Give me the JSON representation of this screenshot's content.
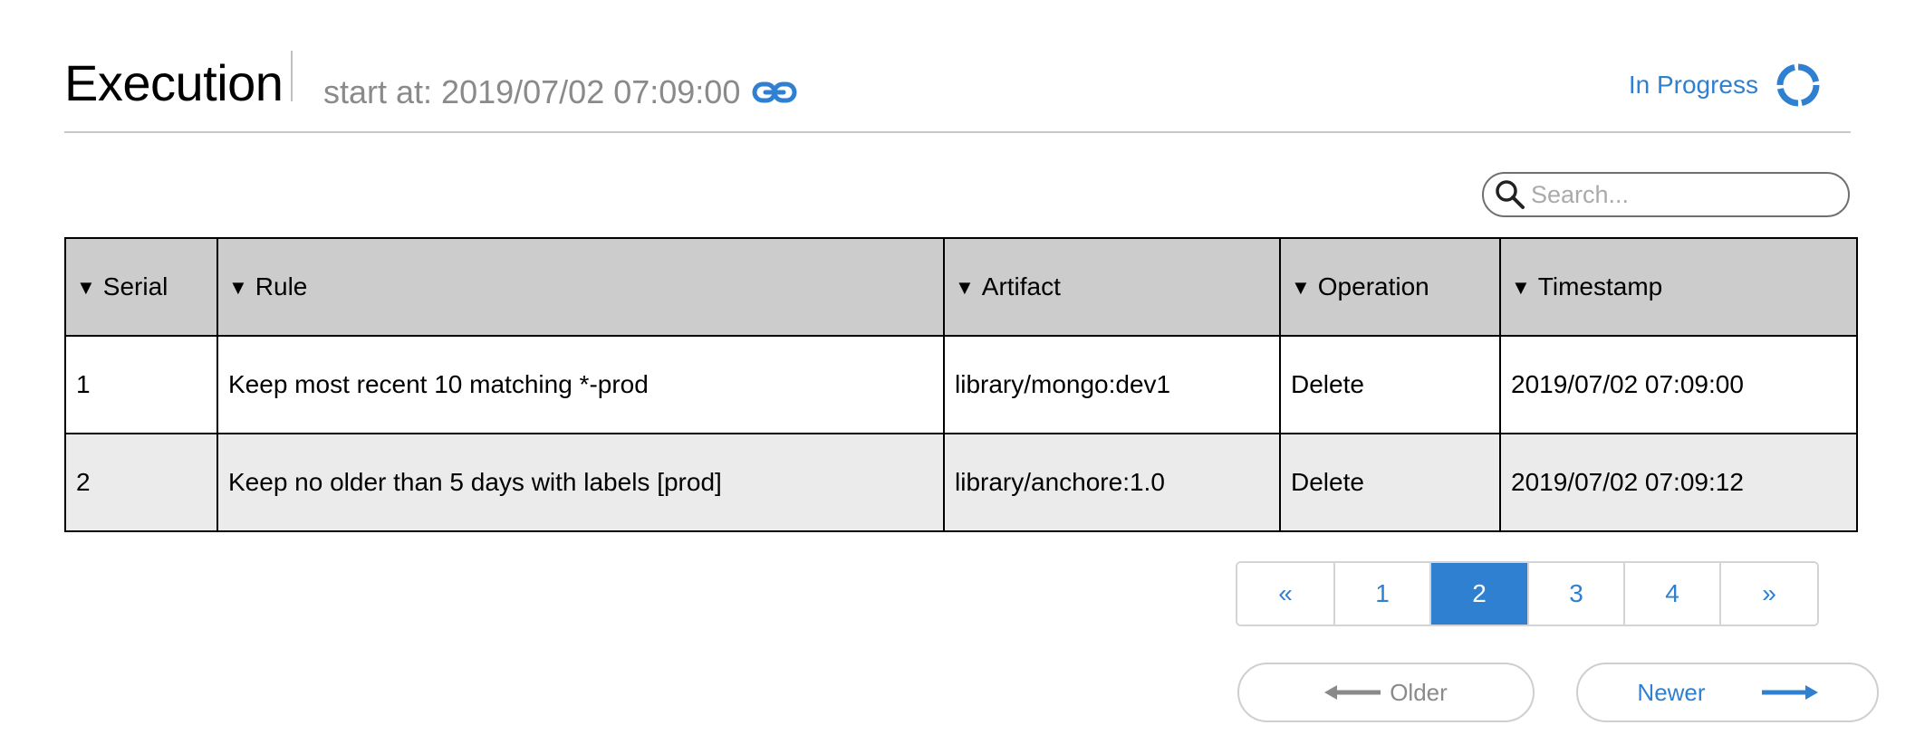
{
  "header": {
    "title": "Execution",
    "start_at": "start at: 2019/07/02 07:09:00",
    "status": "In Progress"
  },
  "search": {
    "placeholder": "Search..."
  },
  "table": {
    "columns": [
      "Serial",
      "Rule",
      "Artifact",
      "Operation",
      "Timestamp"
    ],
    "rows": [
      {
        "serial": "1",
        "rule": "Keep most recent 10 matching *-prod",
        "artifact": "library/mongo:dev1",
        "operation": "Delete",
        "timestamp": "2019/07/02 07:09:00"
      },
      {
        "serial": "2",
        "rule": "Keep no older than 5 days with labels [prod]",
        "artifact": "library/anchore:1.0",
        "operation": "Delete",
        "timestamp": "2019/07/02 07:09:12"
      }
    ]
  },
  "pagination": {
    "prev": "«",
    "pages": [
      "1",
      "2",
      "3",
      "4"
    ],
    "active_page": "2",
    "next": "»"
  },
  "navigation": {
    "older": "Older",
    "newer": "Newer"
  },
  "colors": {
    "accent": "#2f80d1",
    "header_bg": "#cccccc",
    "stripe_bg": "#ebebeb"
  },
  "icons": {
    "link": "link-icon",
    "spinner": "spinner-icon",
    "search": "search-icon",
    "arrow_left": "arrow-left-icon",
    "arrow_right": "arrow-right-icon"
  }
}
